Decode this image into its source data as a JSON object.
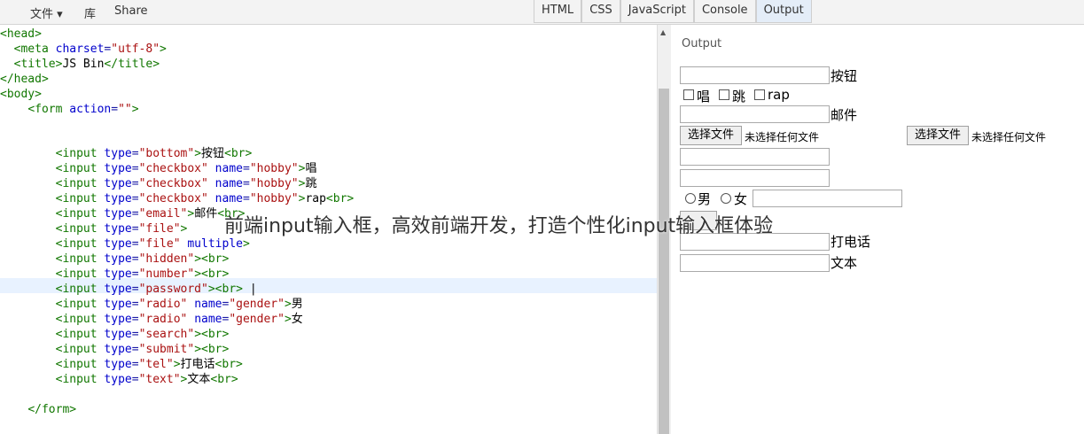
{
  "menu": {
    "file": "文件 ▾",
    "library": "库",
    "share": "Share"
  },
  "tabs": [
    {
      "label": "HTML",
      "active": false
    },
    {
      "label": "CSS",
      "active": false
    },
    {
      "label": "JavaScript",
      "active": false
    },
    {
      "label": "Console",
      "active": false
    },
    {
      "label": "Output",
      "active": true
    }
  ],
  "output": {
    "title": "Output",
    "button_label": "按钮",
    "hobbies": [
      "唱",
      "跳",
      "rap"
    ],
    "email_label": "邮件",
    "file_button": "选择文件",
    "file_status": "未选择任何文件",
    "gender": [
      "男",
      "女"
    ],
    "tel_label": "打电话",
    "text_label": "文本"
  },
  "watermark": "前端input输入框，高效前端开发，打造个性化input输入框体验",
  "colors": {
    "tag": "#117700",
    "attr": "#0000cc",
    "string": "#aa1111",
    "active_tab": "#e4edf8"
  }
}
